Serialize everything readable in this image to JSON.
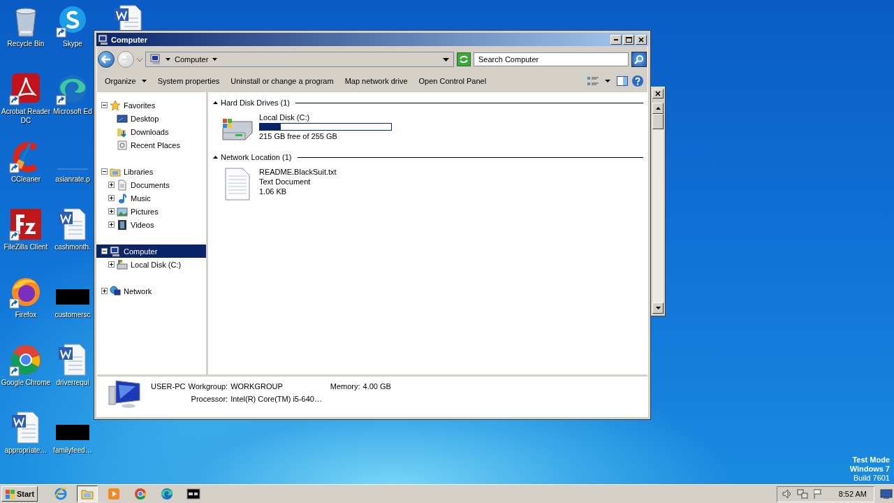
{
  "desktop_icons": [
    {
      "label": "Recycle Bin",
      "kind": "recycle",
      "shortcut": false
    },
    {
      "label": "Acrobat Reader DC",
      "kind": "acrobat",
      "shortcut": true
    },
    {
      "label": "CCleaner",
      "kind": "ccleaner",
      "shortcut": true
    },
    {
      "label": "FileZilla Client",
      "kind": "filezilla",
      "shortcut": true
    },
    {
      "label": "Firefox",
      "kind": "firefox",
      "shortcut": true
    },
    {
      "label": "Google Chrome",
      "kind": "chrome",
      "shortcut": true
    },
    {
      "label": "appropriate…",
      "kind": "word",
      "shortcut": false
    },
    {
      "label": "Skype",
      "kind": "skype",
      "shortcut": true
    },
    {
      "label": "Microsoft Ed",
      "kind": "edge",
      "shortcut": true
    },
    {
      "label": "asianrate.p",
      "kind": "blank",
      "shortcut": false
    },
    {
      "label": "cashmonth.",
      "kind": "word",
      "shortcut": false
    },
    {
      "label": "customersc",
      "kind": "redacted",
      "shortcut": false
    },
    {
      "label": "driverrequi",
      "kind": "word",
      "shortcut": false
    },
    {
      "label": "familyfeed…",
      "kind": "redacted",
      "shortcut": false
    },
    {
      "kind": "word",
      "shortcut": false
    }
  ],
  "window": {
    "title": "Computer"
  },
  "address": {
    "path": "Computer"
  },
  "search": {
    "placeholder": "Search Computer"
  },
  "toolbar": [
    {
      "label": "Organize",
      "dropdown": true
    },
    {
      "label": "System properties",
      "dropdown": false
    },
    {
      "label": "Uninstall or change a program",
      "dropdown": false
    },
    {
      "label": "Map network drive",
      "dropdown": false
    },
    {
      "label": "Open Control Panel",
      "dropdown": false
    }
  ],
  "nav_tree": [
    {
      "label": "Favorites",
      "kind": "star",
      "expanded": true,
      "selected": false,
      "children": [
        {
          "label": "Desktop",
          "kind": "desktop",
          "selected": false
        },
        {
          "label": "Downloads",
          "kind": "downloads",
          "selected": false
        },
        {
          "label": "Recent Places",
          "kind": "recent",
          "selected": false
        }
      ]
    },
    {
      "label": "Libraries",
      "kind": "library",
      "expanded": true,
      "selected": false,
      "children": [
        {
          "label": "Documents",
          "kind": "documents",
          "expanded": false,
          "selected": false
        },
        {
          "label": "Music",
          "kind": "music",
          "expanded": false,
          "selected": false
        },
        {
          "label": "Pictures",
          "kind": "pictures",
          "expanded": false,
          "selected": false
        },
        {
          "label": "Videos",
          "kind": "videos",
          "expanded": false,
          "selected": false
        }
      ]
    },
    {
      "label": "Computer",
      "kind": "computer",
      "expanded": true,
      "selected": true,
      "children": [
        {
          "label": "Local Disk (C:)",
          "kind": "drive",
          "expanded": false,
          "selected": false
        }
      ]
    },
    {
      "label": "Network",
      "kind": "network",
      "expanded": false,
      "selected": false
    }
  ],
  "groups": [
    {
      "title": "Hard Disk Drives (1)",
      "expanded": true,
      "items": [
        {
          "kind": "drive",
          "name": "Local Disk (C:)",
          "level": 0.16,
          "lines": [
            "215 GB free of 255 GB"
          ]
        }
      ]
    },
    {
      "title": "Network Location (1)",
      "expanded": true,
      "items": [
        {
          "kind": "file",
          "name": "README.BlackSuit.txt",
          "lines": [
            "Text Document",
            "1.06 KB"
          ]
        }
      ]
    }
  ],
  "details": {
    "name": "USER-PC",
    "fields": [
      {
        "label": "Workgroup:",
        "value": "WORKGROUP"
      },
      {
        "label": "Memory:",
        "value": "4.00 GB"
      },
      {
        "label": "Processor:",
        "value": "Intel(R) Core(TM) i5-640…"
      }
    ]
  },
  "os_notice": [
    "Test Mode",
    "Windows 7",
    "Build 7601"
  ],
  "taskbar": {
    "start": "Start",
    "apps": [
      {
        "kind": "ie",
        "selected": false
      },
      {
        "kind": "explorer",
        "selected": true
      },
      {
        "kind": "media",
        "selected": false
      },
      {
        "kind": "chrome",
        "selected": false
      },
      {
        "kind": "edge",
        "selected": false
      },
      {
        "kind": "cmd",
        "selected": false
      }
    ],
    "time": "8:52 AM"
  }
}
